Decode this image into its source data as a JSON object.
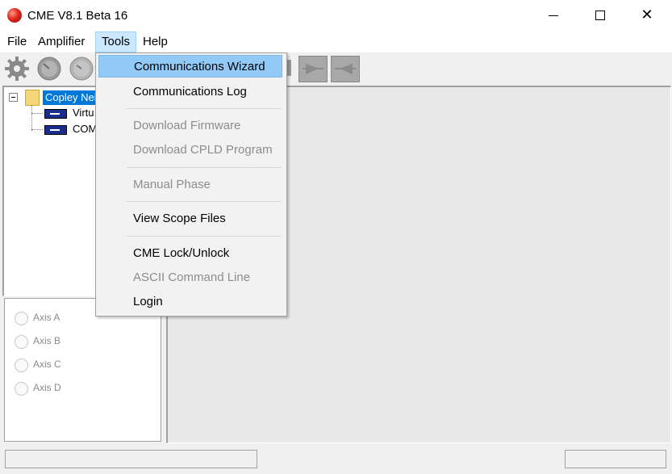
{
  "window": {
    "title": "CME V8.1 Beta 16"
  },
  "title_buttons": {
    "minimize": "—",
    "maximize": "☐",
    "close": "✕"
  },
  "menubar": {
    "items": [
      {
        "label": "File"
      },
      {
        "label": "Amplifier"
      },
      {
        "label": "Tools"
      },
      {
        "label": "Help"
      }
    ]
  },
  "toolbar": {
    "icons": [
      "gear-icon",
      "gauge-icon",
      "gauge-icon",
      "arrow-forward-icon",
      "arrow-back-icon"
    ]
  },
  "tree": {
    "root": "Copley Nei",
    "nodes": [
      {
        "label": "Virtu"
      },
      {
        "label": "COM"
      }
    ]
  },
  "axes": {
    "items": [
      {
        "label": "Axis A"
      },
      {
        "label": "Axis B"
      },
      {
        "label": "Axis C"
      },
      {
        "label": "Axis D"
      }
    ]
  },
  "tools_menu": {
    "items": [
      {
        "label": "Communications Wizard",
        "enabled": true,
        "highlighted": true
      },
      {
        "label": "Communications Log",
        "enabled": true
      },
      {
        "label": "Download Firmware",
        "enabled": false
      },
      {
        "label": "Download CPLD Program",
        "enabled": false
      },
      {
        "label": "Manual Phase",
        "enabled": false
      },
      {
        "label": "View Scope Files",
        "enabled": true
      },
      {
        "label": "CME Lock/Unlock",
        "enabled": true
      },
      {
        "label": "ASCII Command Line",
        "enabled": false
      },
      {
        "label": "Login",
        "enabled": true
      }
    ]
  },
  "colors": {
    "selection": "#0078d7",
    "menu_highlight": "#91c9f7",
    "disabled_text": "#8d8d8d"
  }
}
